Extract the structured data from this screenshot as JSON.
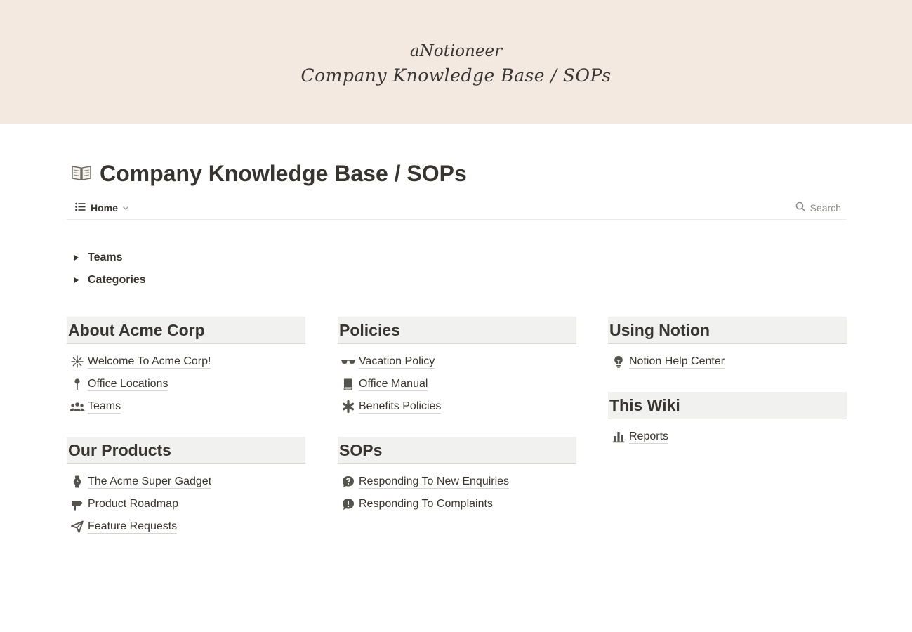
{
  "cover": {
    "brand": "aNotioneer",
    "title": "Company Knowledge Base / SOPs"
  },
  "page": {
    "icon": "open-book-icon",
    "title": "Company Knowledge Base / SOPs"
  },
  "view_bar": {
    "view_label": "Home",
    "search_label": "Search"
  },
  "toggles": [
    {
      "label": "Teams"
    },
    {
      "label": "Categories"
    }
  ],
  "sections": {
    "about": {
      "title": "About Acme Corp",
      "items": [
        {
          "label": "Welcome To Acme Corp!",
          "icon": "sparkle-icon"
        },
        {
          "label": "Office Locations",
          "icon": "pin-icon"
        },
        {
          "label": "Teams",
          "icon": "people-icon"
        }
      ]
    },
    "products": {
      "title": "Our Products",
      "items": [
        {
          "label": "The Acme Super Gadget",
          "icon": "watch-icon"
        },
        {
          "label": "Product Roadmap",
          "icon": "signpost-icon"
        },
        {
          "label": "Feature Requests",
          "icon": "paper-plane-icon"
        }
      ]
    },
    "policies": {
      "title": "Policies",
      "items": [
        {
          "label": "Vacation Policy",
          "icon": "sunglasses-icon"
        },
        {
          "label": "Office Manual",
          "icon": "book-icon"
        },
        {
          "label": "Benefits Policies",
          "icon": "asterisk-icon"
        }
      ]
    },
    "sops": {
      "title": "SOPs",
      "items": [
        {
          "label": "Responding To New Enquiries",
          "icon": "question-bubble-icon"
        },
        {
          "label": "Responding To Complaints",
          "icon": "exclamation-bubble-icon"
        }
      ]
    },
    "notion": {
      "title": "Using Notion",
      "items": [
        {
          "label": "Notion Help Center",
          "icon": "lightbulb-icon"
        }
      ]
    },
    "wiki": {
      "title": "This Wiki",
      "items": [
        {
          "label": "Reports",
          "icon": "bar-chart-icon"
        }
      ]
    }
  }
}
